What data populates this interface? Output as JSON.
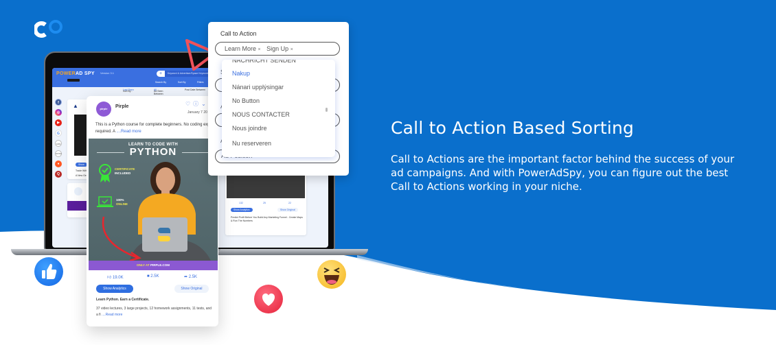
{
  "colors": {
    "background": "#0a6fcc",
    "accent": "#3a6fe0",
    "white": "#ffffff",
    "ad_purple": "#8b59d2"
  },
  "hero": {
    "title": "Call to Action Based Sorting",
    "description": "Call to Actions are the important factor behind the success of your ad campaigns. And with PowerAdSpy, you can figure out the best Call to Actions working in your niche."
  },
  "app_screen": {
    "brand_part1": "POWER",
    "brand_part2": "AD SPY",
    "version": "Version 3.1",
    "search_placeholder": "Keyword & Advertiser/Space Keywords",
    "menu": [
      "Search By",
      "Sort By",
      "Filters"
    ],
    "sortbar": {
      "sort_by_label": "Sort By :",
      "sort_by_value": "Last Seen",
      "ad_seen_label": "Ad Seen Between :",
      "ad_seen_value": "All",
      "post_date_label": "Post Date Between"
    },
    "side_icons": [
      "facebook-icon",
      "instagram-icon",
      "youtube-icon",
      "google-icon",
      "gdn-icon",
      "native-icon",
      "reddit-icon",
      "quora-icon"
    ],
    "bg_post": {
      "stats": [
        "132",
        "25",
        "22"
      ],
      "analytics": "Show Analytics",
      "original": "Show Original",
      "text": "Predict Profit Before You Build Any Marketing Funnel - Create Maps & Run The Numbers"
    },
    "left_card": {
      "text1": "Trade With",
      "text2": "A New Gen"
    }
  },
  "post_card": {
    "avatar_text": "pirple",
    "advertiser": "Pirple",
    "date": "January 7 20",
    "description": "This is a Python course for complete beginners. No coding experience required. A ",
    "read_more": "....Read more",
    "ad_image": {
      "subtitle": "LEARN TO CODE WITH",
      "title": "PYTHON",
      "cert_line1": "CERTIFICATE",
      "cert_line2": "INCLUDED",
      "online_line1": "100%",
      "online_line2": "ONLINE",
      "footer_prefix": "ONLY AT",
      "footer_site": "PIRPLE.COM"
    },
    "likes": "19.0K",
    "comments": "2.5K",
    "shares": "2.5K",
    "show_analytics": "Show Analytics",
    "show_original": "Show Original",
    "headline": "Learn Python. Earn a Certificate.",
    "body": "37 video lectures, 3 large projects, 12 homework assignments, 11 tests, and a fi ",
    "body_read_more": "....Read more"
  },
  "filter_panel": {
    "label": "Call to Action",
    "selected_tags": [
      "Learn More",
      "Sign Up"
    ],
    "hidden_labels": [
      "S",
      "A",
      "A"
    ],
    "ad_position_placeholder": "Ad Position",
    "dropdown_options": [
      {
        "label": "NACHRICHT SENDEN",
        "active": false
      },
      {
        "label": "Nakup",
        "active": true
      },
      {
        "label": "Nánari upplýsingar",
        "active": false
      },
      {
        "label": "No Button",
        "active": false
      },
      {
        "label": "NOUS CONTACTER",
        "active": false
      },
      {
        "label": "Nous joindre",
        "active": false
      },
      {
        "label": "Nu reserveren",
        "active": false
      }
    ]
  },
  "reactions": [
    "like-reaction",
    "love-reaction",
    "haha-reaction"
  ]
}
